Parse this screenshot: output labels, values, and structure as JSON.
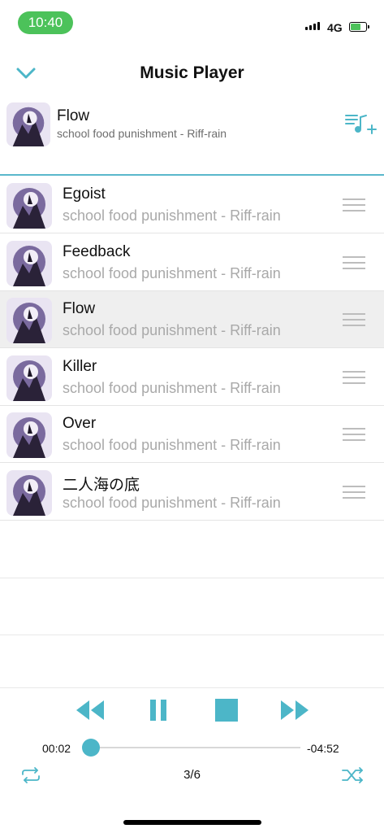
{
  "status": {
    "time": "10:40",
    "network": "4G"
  },
  "header": {
    "title": "Music Player"
  },
  "now_playing": {
    "title": "Flow",
    "subtitle": "school food punishment - Riff-rain"
  },
  "queue": [
    {
      "title": "Egoist",
      "subtitle": "school food punishment - Riff-rain",
      "active": false
    },
    {
      "title": "Feedback",
      "subtitle": "school food punishment - Riff-rain",
      "active": false
    },
    {
      "title": "Flow",
      "subtitle": "school food punishment - Riff-rain",
      "active": true
    },
    {
      "title": "Killer",
      "subtitle": "school food punishment - Riff-rain",
      "active": false
    },
    {
      "title": "Over",
      "subtitle": "school food punishment - Riff-rain",
      "active": false
    },
    {
      "title": "二人海の底",
      "subtitle": "school food punishment - Riff-rain",
      "active": false
    }
  ],
  "player": {
    "elapsed": "00:02",
    "remaining": "-04:52",
    "progress": 0.01,
    "counter": "3/6"
  },
  "colors": {
    "accent": "#4cb6c8",
    "status_green": "#4cc25a"
  },
  "icons": [
    "chevron-down-icon",
    "add-to-playlist-icon",
    "rewind-icon",
    "pause-icon",
    "stop-icon",
    "fast-forward-icon",
    "repeat-icon",
    "shuffle-icon",
    "drag-handle-icon"
  ]
}
